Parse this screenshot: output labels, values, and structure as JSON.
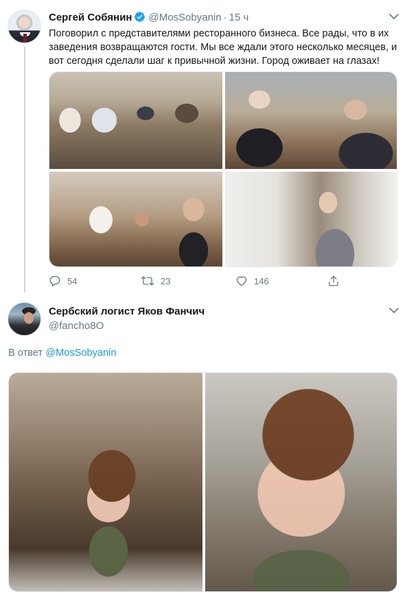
{
  "colors": {
    "link": "#1b95e0",
    "secondary_text": "#657786",
    "verified_blue": "#1da1f2",
    "thread_line": "#ccd6dd"
  },
  "tweet1": {
    "author_name": "Сергей Собянин",
    "verified": true,
    "handle": "@MosSobyanin",
    "separator": "·",
    "time": "15 ч",
    "text": "Поговорил с представителями ресторанного бизнеса. Все рады, что в их заведения возвращаются гости. Мы все ждали этого несколько месяцев, и вот сегодня сделали шаг к привычной жизни. Город оживает на глазах!",
    "photo_count": 4,
    "replies": "54",
    "retweets": "23",
    "likes": "146",
    "icons": [
      "reply-icon",
      "retweet-icon",
      "like-icon",
      "share-icon",
      "chevron-down-icon",
      "verified-icon"
    ]
  },
  "tweet2": {
    "author_name": "Сербский логист Яков Фанчич",
    "handle": "@fancho8O",
    "reply_prefix": "В ответ",
    "reply_mention": "@MosSobyanin",
    "photo_count": 2
  }
}
